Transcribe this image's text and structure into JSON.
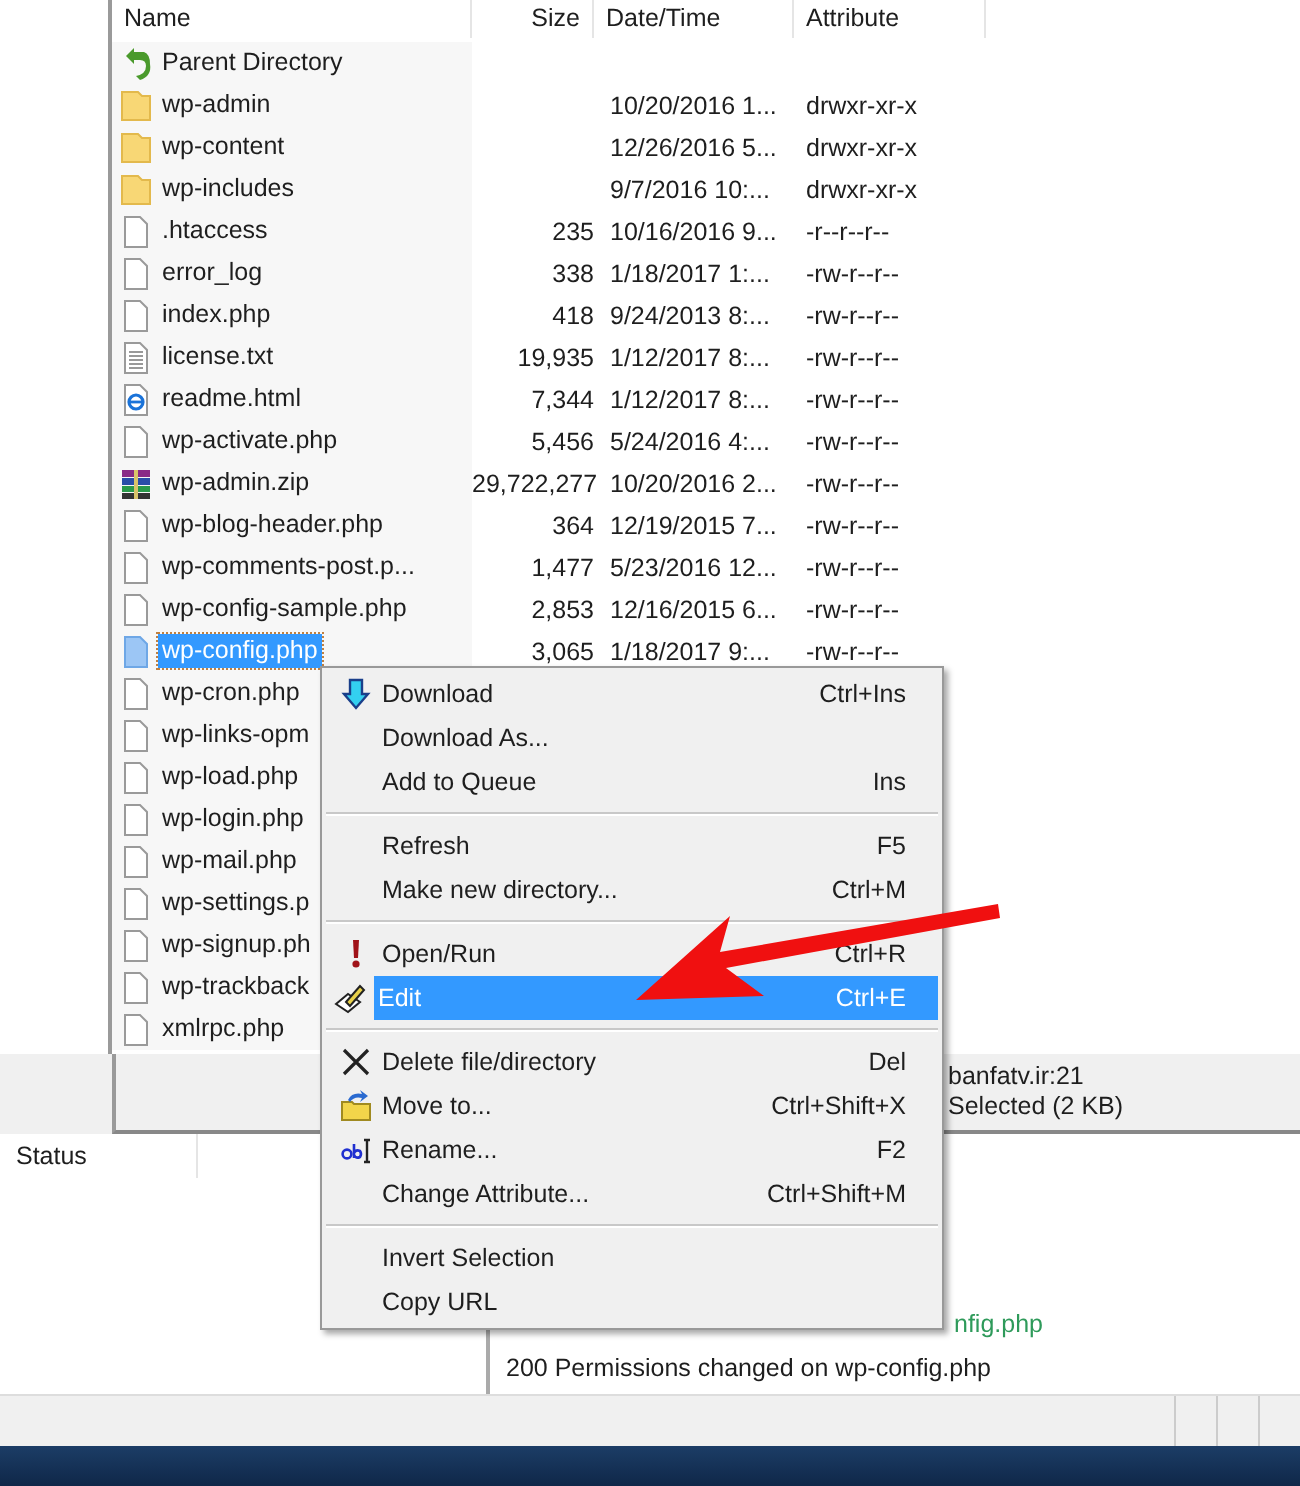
{
  "file_list": {
    "columns": [
      "Name",
      "Size",
      "Date/Time",
      "Attribute"
    ],
    "rows": [
      {
        "kind": "parent",
        "name": "Parent Directory",
        "selected": false
      },
      {
        "kind": "folder",
        "name": "wp-admin",
        "date": "10/20/2016 1...",
        "attribute": "drwxr-xr-x",
        "selected": false
      },
      {
        "kind": "folder",
        "name": "wp-content",
        "date": "12/26/2016 5...",
        "attribute": "drwxr-xr-x",
        "selected": false
      },
      {
        "kind": "folder",
        "name": "wp-includes",
        "date": "9/7/2016 10:...",
        "attribute": "drwxr-xr-x",
        "selected": false
      },
      {
        "kind": "file",
        "name": ".htaccess",
        "size": "235",
        "date": "10/16/2016 9...",
        "attribute": "-r--r--r--",
        "selected": false
      },
      {
        "kind": "file",
        "name": "error_log",
        "size": "338",
        "date": "1/18/2017 1:...",
        "attribute": "-rw-r--r--",
        "selected": false
      },
      {
        "kind": "file",
        "name": "index.php",
        "size": "418",
        "date": "9/24/2013 8:...",
        "attribute": "-rw-r--r--",
        "selected": false
      },
      {
        "kind": "text",
        "name": "license.txt",
        "size": "19,935",
        "date": "1/12/2017 8:...",
        "attribute": "-rw-r--r--",
        "selected": false
      },
      {
        "kind": "html",
        "name": "readme.html",
        "size": "7,344",
        "date": "1/12/2017 8:...",
        "attribute": "-rw-r--r--",
        "selected": false
      },
      {
        "kind": "file",
        "name": "wp-activate.php",
        "size": "5,456",
        "date": "5/24/2016 4:...",
        "attribute": "-rw-r--r--",
        "selected": false
      },
      {
        "kind": "archive",
        "name": "wp-admin.zip",
        "size": "29,722,277",
        "date": "10/20/2016 2...",
        "attribute": "-rw-r--r--",
        "selected": false
      },
      {
        "kind": "file",
        "name": "wp-blog-header.php",
        "size": "364",
        "date": "12/19/2015 7...",
        "attribute": "-rw-r--r--",
        "selected": false
      },
      {
        "kind": "file",
        "name": "wp-comments-post.p...",
        "size": "1,477",
        "date": "5/23/2016 12...",
        "attribute": "-rw-r--r--",
        "selected": false
      },
      {
        "kind": "file",
        "name": "wp-config-sample.php",
        "size": "2,853",
        "date": "12/16/2015 6...",
        "attribute": "-rw-r--r--",
        "selected": false
      },
      {
        "kind": "file",
        "name": "wp-config.php",
        "size": "3,065",
        "date": "1/18/2017 9:...",
        "attribute": "-rw-r--r--",
        "selected": true
      },
      {
        "kind": "file",
        "name": "wp-cron.php",
        "selected": false
      },
      {
        "kind": "file",
        "name": "wp-links-opm",
        "selected": false
      },
      {
        "kind": "file",
        "name": "wp-load.php",
        "selected": false
      },
      {
        "kind": "file",
        "name": "wp-login.php",
        "selected": false
      },
      {
        "kind": "file",
        "name": "wp-mail.php",
        "selected": false
      },
      {
        "kind": "file",
        "name": "wp-settings.p",
        "selected": false
      },
      {
        "kind": "file",
        "name": "wp-signup.ph",
        "selected": false
      },
      {
        "kind": "file",
        "name": "wp-trackback",
        "selected": false
      },
      {
        "kind": "file",
        "name": "xmlrpc.php",
        "selected": false
      }
    ]
  },
  "selection_status": [
    "banfatv.ir:21",
    "Selected (2 KB)"
  ],
  "transfer_queue": {
    "columns": [
      "Status"
    ]
  },
  "log": [
    {
      "text": "nfig.php",
      "kind": "success"
    },
    {
      "text": "200 Permissions changed on wp-config.php",
      "kind": "response"
    }
  ],
  "context_menu": {
    "sections": [
      {
        "items": [
          {
            "kind": "download",
            "label": "Download",
            "shortcut": "Ctrl+Ins",
            "selected": false
          },
          {
            "kind": "plain",
            "label": "Download As...",
            "selected": false
          },
          {
            "kind": "plain",
            "label": "Add to Queue",
            "shortcut": "Ins",
            "selected": false
          }
        ]
      },
      {
        "items": [
          {
            "kind": "plain",
            "label": "Refresh",
            "shortcut": "F5",
            "selected": false
          },
          {
            "kind": "plain",
            "label": "Make new directory...",
            "shortcut": "Ctrl+M",
            "selected": false
          }
        ]
      },
      {
        "items": [
          {
            "kind": "open",
            "label": "Open/Run",
            "shortcut": "Ctrl+R",
            "selected": false
          },
          {
            "kind": "edit",
            "label": "Edit",
            "shortcut": "Ctrl+E",
            "selected": true
          }
        ]
      },
      {
        "items": [
          {
            "kind": "delete",
            "label": "Delete file/directory",
            "shortcut": "Del",
            "selected": false
          },
          {
            "kind": "move",
            "label": "Move to...",
            "shortcut": "Ctrl+Shift+X",
            "selected": false
          },
          {
            "kind": "rename",
            "label": "Rename...",
            "shortcut": "F2",
            "selected": false
          },
          {
            "kind": "plain",
            "label": "Change Attribute...",
            "shortcut": "Ctrl+Shift+M",
            "selected": false
          }
        ]
      },
      {
        "items": [
          {
            "kind": "plain",
            "label": "Invert Selection",
            "selected": false
          },
          {
            "kind": "plain",
            "label": "Copy URL",
            "selected": false
          }
        ]
      }
    ]
  }
}
